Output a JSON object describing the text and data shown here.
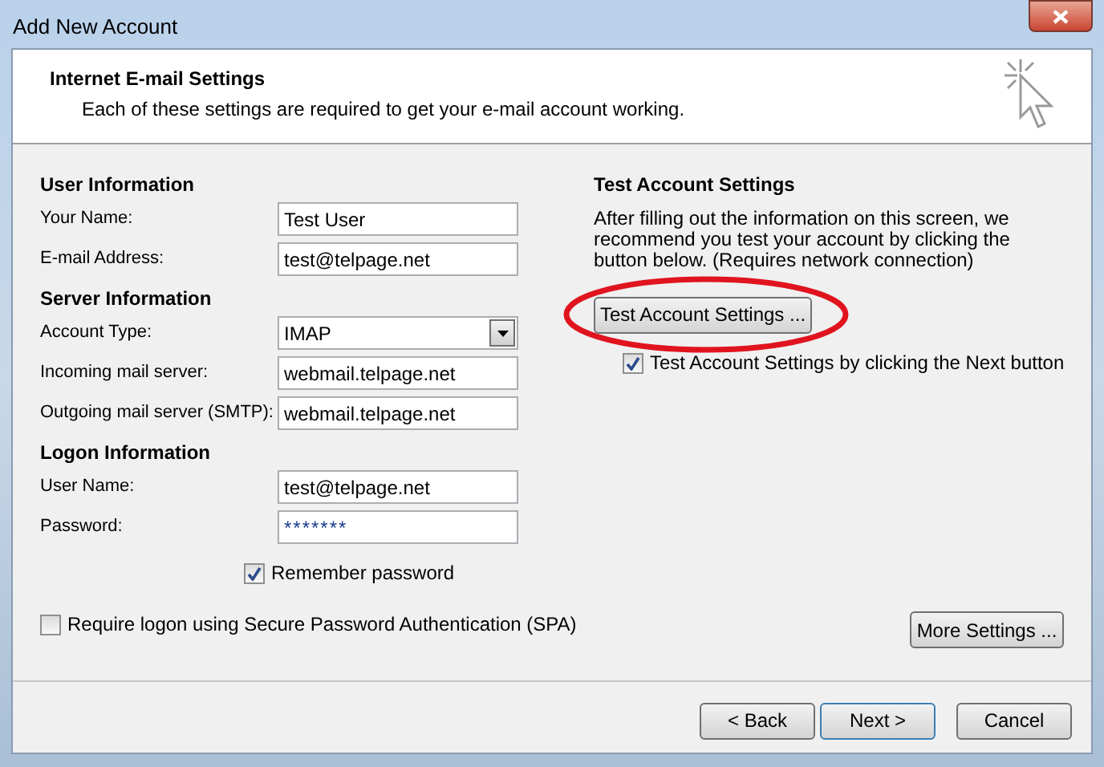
{
  "window": {
    "title": "Add New Account"
  },
  "header": {
    "title": "Internet E-mail Settings",
    "subtitle": "Each of these settings are required to get your e-mail account working."
  },
  "sections": [
    {
      "heading": "User Information",
      "fields": [
        {
          "label": "Your Name:",
          "kind": "text",
          "value": "Test User"
        },
        {
          "label": "E-mail Address:",
          "kind": "text",
          "value": "test@telpage.net"
        }
      ]
    },
    {
      "heading": "Server Information",
      "fields": [
        {
          "label": "Account Type:",
          "kind": "dropdown",
          "value": "IMAP"
        },
        {
          "label": "Incoming mail server:",
          "kind": "text",
          "value": "webmail.telpage.net"
        },
        {
          "label": "Outgoing mail server (SMTP):",
          "kind": "text",
          "value": "webmail.telpage.net"
        }
      ]
    },
    {
      "heading": "Logon Information",
      "fields": [
        {
          "label": "User Name:",
          "kind": "text",
          "value": "test@telpage.net"
        },
        {
          "label": "Password:",
          "kind": "password",
          "value": "*******"
        }
      ]
    }
  ],
  "remember_password": {
    "label": "Remember password",
    "checked": true
  },
  "spa": {
    "label": "Require logon using Secure Password Authentication (SPA)",
    "checked": false
  },
  "test_settings": {
    "heading": "Test Account Settings",
    "description": "After filling out the information on this screen, we recommend you test your account by clicking the button below. (Requires network connection)",
    "button": "Test Account Settings ...",
    "auto_test": {
      "label": "Test Account Settings by clicking the Next button",
      "checked": true
    }
  },
  "more_settings_button": "More Settings ...",
  "buttons": [
    {
      "label": "< Back",
      "default": false
    },
    {
      "label": "Next >",
      "default": true
    },
    {
      "label": "Cancel",
      "default": false
    }
  ]
}
